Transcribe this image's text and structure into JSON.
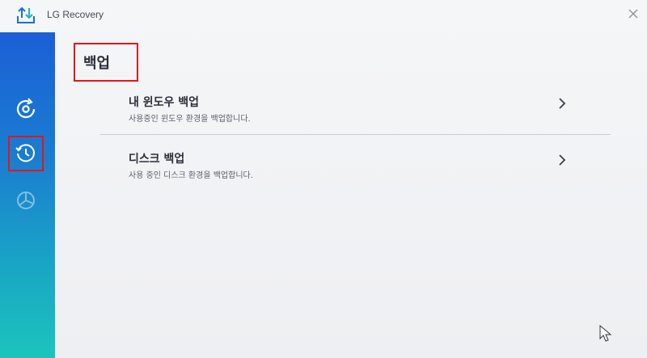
{
  "window": {
    "app_title": "LG Recovery"
  },
  "sidebar": {
    "items": [
      {
        "icon": "disc-restore-icon",
        "selected": false
      },
      {
        "icon": "history-backup-icon",
        "selected": true
      },
      {
        "icon": "disk-partition-icon",
        "selected": false
      }
    ]
  },
  "main": {
    "page_title": "백업",
    "options": [
      {
        "title": "내 윈도우 백업",
        "description": "사용중인 윈도우 환경을 백업합니다.",
        "icon": "chevron-right-icon"
      },
      {
        "title": "디스크 백업",
        "description": "사용 중인 디스크 환경을 백업합니다.",
        "icon": "chevron-right-icon"
      }
    ]
  },
  "colors": {
    "accent": "#1b5fd6",
    "sidebar_bottom": "#1cc4bd",
    "highlight": "#e4161c"
  }
}
